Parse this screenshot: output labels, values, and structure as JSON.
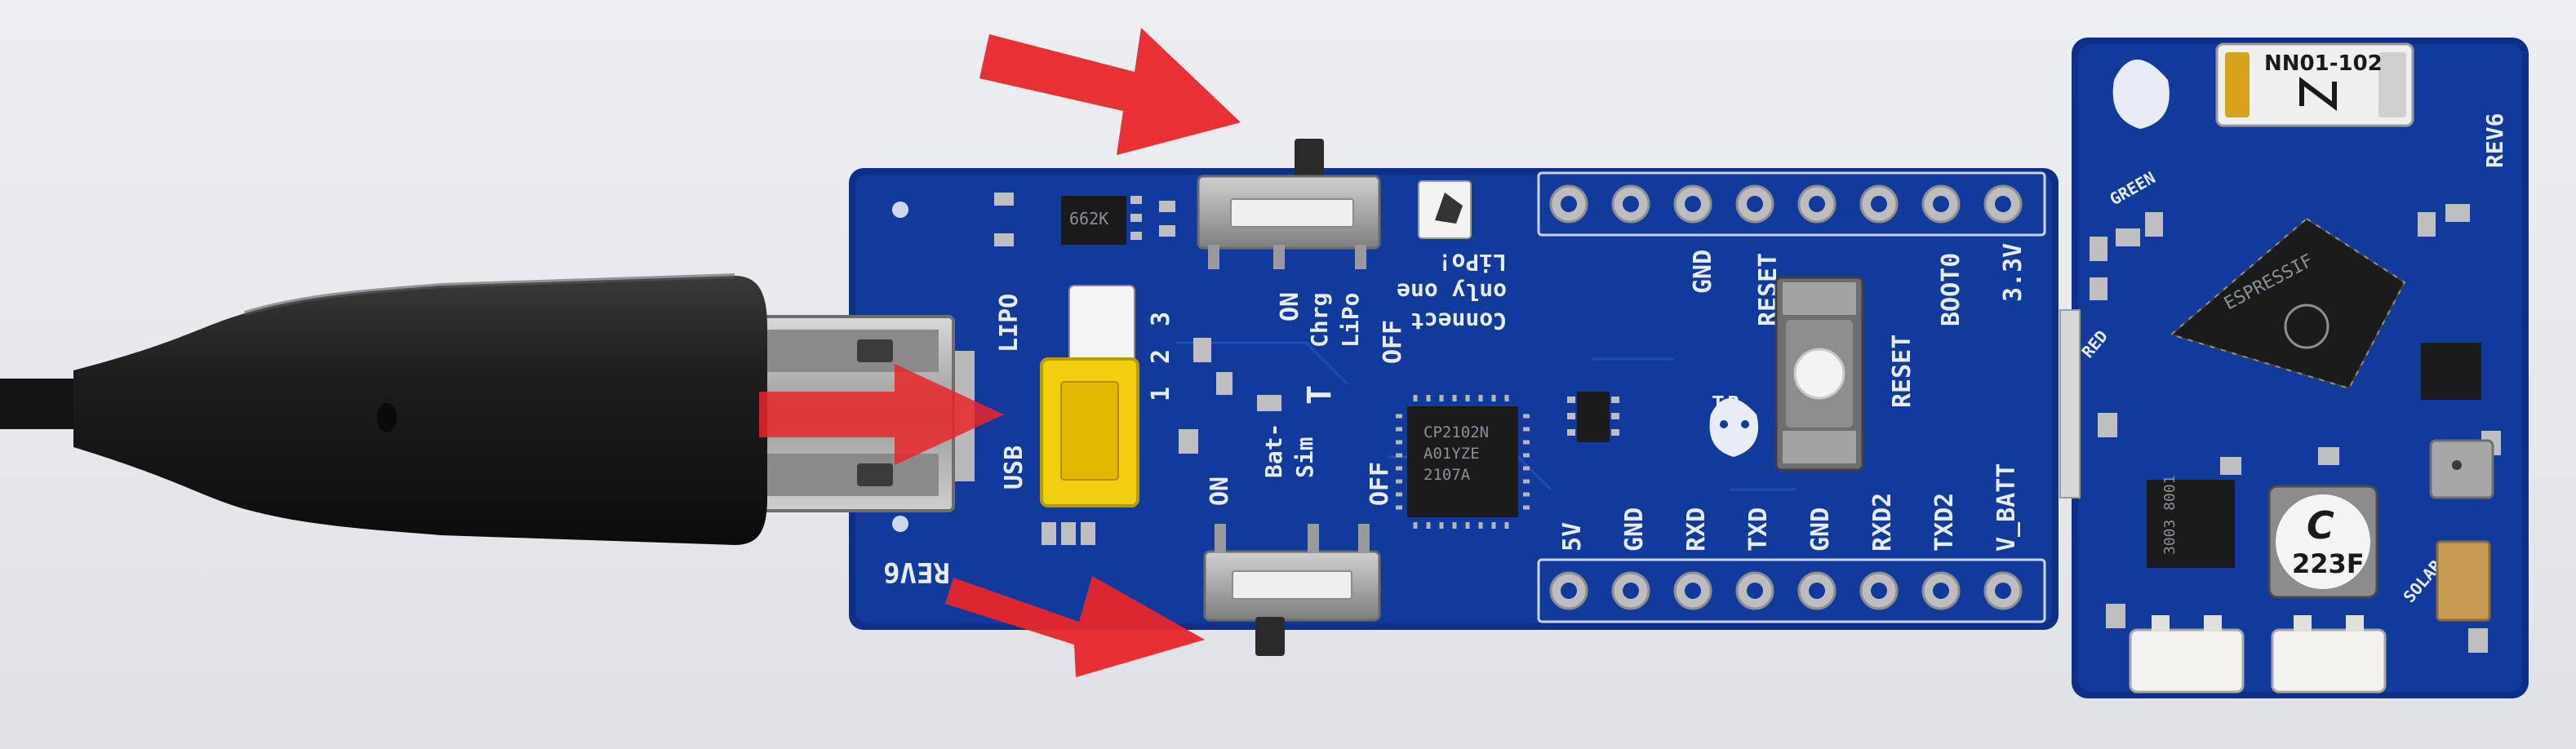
{
  "main_board": {
    "rev": "REV6",
    "jumper_labels": {
      "top": "LIPO",
      "bottom": "USB"
    },
    "jumper_pins": [
      "3",
      "2",
      "1"
    ],
    "charge_switch": {
      "on": "ON",
      "off": "OFF",
      "label_1": "Chrg",
      "label_2": "LiPo"
    },
    "battery_switch": {
      "on": "ON",
      "off": "OFF",
      "label_1": "Bat-",
      "label_2": "Sim"
    },
    "note_lines": [
      "Connect",
      "only one",
      "LiPo!"
    ],
    "usb_chip": {
      "line1": "CP2102N",
      "line2": "A01YZE",
      "line3": "2107A"
    },
    "regulator_mark": "662K",
    "logo_text": "T.R.",
    "button_label": "RESET",
    "top_header_pins": [
      "GND",
      "RESET",
      "BOOT0",
      "3.3V"
    ],
    "bottom_header_pins": [
      "5V",
      "GND",
      "RXD",
      "TXD",
      "GND",
      "RXD2",
      "TXD2",
      "V_BATT"
    ],
    "small_mark": "T"
  },
  "module_board": {
    "rev": "REV6",
    "led_label": "GREEN",
    "red_label": "RED",
    "solar_label": "SOLAR",
    "sensor_mark": "NN01-102",
    "supercap_mark": "223F",
    "supercap_symbol": "C",
    "chip_mark": "ESPRESSIF",
    "bottom_chip_mark": "3003 8001"
  },
  "annotations": {
    "arrow_color": "#e8262a",
    "arrow_count": 3
  }
}
